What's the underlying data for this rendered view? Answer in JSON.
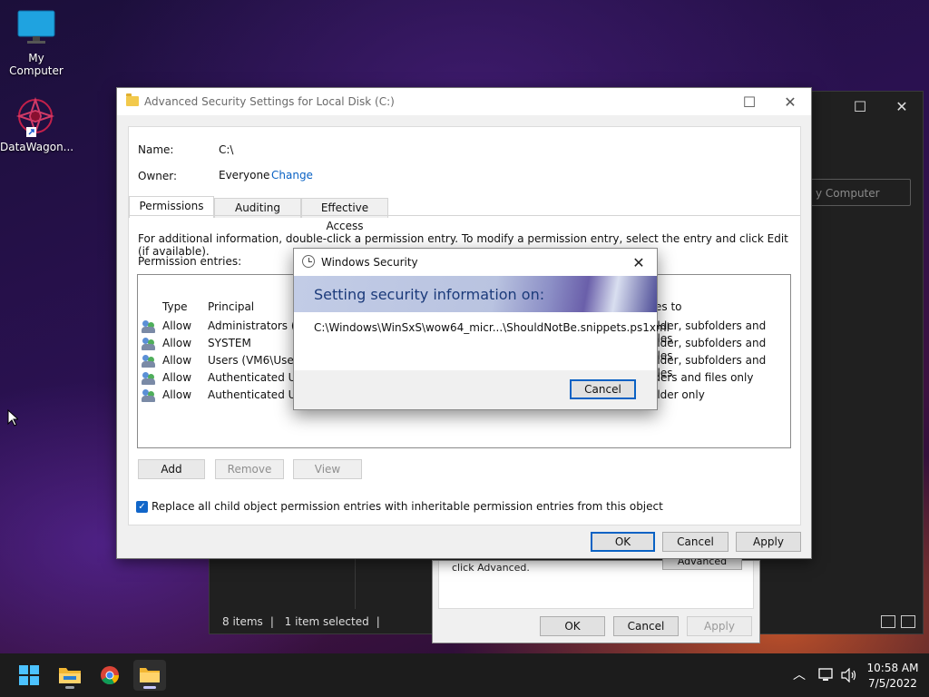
{
  "desktop": {
    "icons": [
      {
        "label": "My Computer"
      },
      {
        "label": "DataWagon..."
      }
    ]
  },
  "bg_explorer": {
    "address_fragment": "y Computer",
    "status": {
      "items": "8 items",
      "selected": "1 item selected"
    }
  },
  "bg_properties": {
    "text": "click Advanced.",
    "advanced_label": "Advanced",
    "ok_label": "OK",
    "cancel_label": "Cancel",
    "apply_label": "Apply"
  },
  "advanced_security": {
    "title": "Advanced Security Settings for Local Disk (C:)",
    "name_label": "Name:",
    "name_value": "C:\\",
    "owner_label": "Owner:",
    "owner_value": "Everyone",
    "change_link": "Change",
    "tabs": [
      "Permissions",
      "Auditing",
      "Effective Access"
    ],
    "info_text": "For additional information, double-click a permission entry. To modify a permission entry, select the entry and click Edit (if available).",
    "entries_label": "Permission entries:",
    "columns": {
      "type": "Type",
      "principal": "Principal",
      "applies_to": "es to"
    },
    "rows": [
      {
        "type": "Allow",
        "principal": "Administrators (VM",
        "applies": "older, subfolders and files"
      },
      {
        "type": "Allow",
        "principal": "SYSTEM",
        "applies": "older, subfolders and files"
      },
      {
        "type": "Allow",
        "principal": "Users (VM6\\Users)",
        "applies": "older, subfolders and files"
      },
      {
        "type": "Allow",
        "principal": "Authenticated Use",
        "applies": "lders and files only"
      },
      {
        "type": "Allow",
        "principal": "Authenticated Use",
        "applies": "older only"
      }
    ],
    "add_label": "Add",
    "remove_label": "Remove",
    "view_label": "View",
    "replace_label": "Replace all child object permission entries with inheritable permission entries from this object",
    "ok_label": "OK",
    "cancel_label": "Cancel",
    "apply_label": "Apply"
  },
  "windows_security": {
    "title": "Windows Security",
    "heading": "Setting security information on:",
    "path": "C:\\Windows\\WinSxS\\wow64_micr...\\ShouldNotBe.snippets.ps1xml",
    "cancel_label": "Cancel"
  },
  "taskbar": {
    "time": "10:58 AM",
    "date": "7/5/2022",
    "apps": [
      "start-icon",
      "file-explorer-icon",
      "chrome-icon",
      "folder-icon"
    ]
  },
  "colors": {
    "accent": "#0a62c4"
  }
}
